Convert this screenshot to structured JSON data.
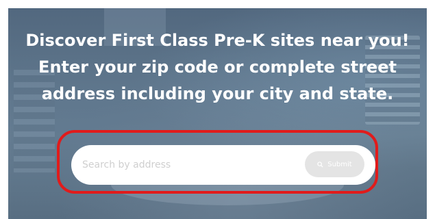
{
  "headline": {
    "line1": "Discover First Class Pre-K sites near you!",
    "line2": "Enter your zip code or complete street",
    "line3": "address including your city and state."
  },
  "search": {
    "placeholder": "Search by address",
    "value": "",
    "submit_label": "Submit",
    "submit_icon": "search-icon"
  },
  "colors": {
    "highlight_outline": "#e11b1b",
    "submit_button_bg": "#e4e4e4",
    "headline_text": "#ffffff"
  }
}
